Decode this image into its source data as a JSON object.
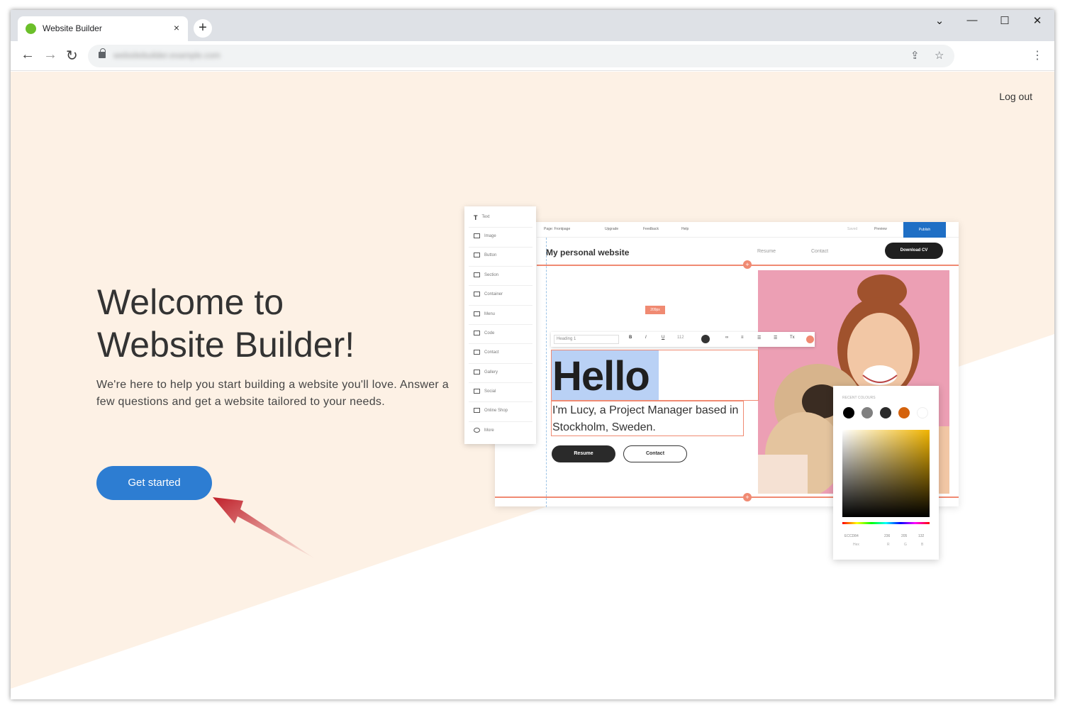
{
  "browser": {
    "tab_title": "Website Builder",
    "tab_close": "×",
    "new_tab": "+",
    "url": "websitebuilder.example.com",
    "controls": {
      "minimize": "—",
      "maximize": "☐",
      "close": "✕",
      "tablist": "⌄"
    }
  },
  "page": {
    "logout": "Log out",
    "title_line1": "Welcome to",
    "title_line2": "Website Builder!",
    "intro": "We're here to help you start building a website you'll love. Answer a few questions and get a website tailored to your needs.",
    "cta": "Get started"
  },
  "mockup": {
    "panel_items": [
      "Text",
      "Image",
      "Button",
      "Section",
      "Container",
      "Menu",
      "Code",
      "Contact",
      "Gallery",
      "Social",
      "Online Shop",
      "More"
    ],
    "topbar": {
      "page": "Page: Frontpage",
      "upgrade": "Upgrade",
      "feedback": "Feedback",
      "help": "Help",
      "saved": "Saved",
      "preview": "Preview",
      "publish": "Publish"
    },
    "site_title": "My personal website",
    "nav": [
      "Resume",
      "Contact"
    ],
    "download_cv": "Download CV",
    "size_tag": "209px",
    "format": {
      "style": "Heading 1",
      "size": "112"
    },
    "hello": "Hello",
    "lucy": "I'm Lucy, a Project Manager based in Stockholm, Sweden.",
    "btn_resume": "Resume",
    "btn_contact": "Contact",
    "picker": {
      "label": "RECENT COLOURS",
      "swatches": [
        "#000000",
        "#808080",
        "#2a2a2a",
        "#d4620c",
        "#ffffff"
      ],
      "hex": "ECCD84",
      "r": "236",
      "g": "205",
      "b": "132",
      "hex_label": "Hex",
      "r_label": "R",
      "g_label": "G",
      "b_label": "B"
    }
  },
  "colors": {
    "bg_beige": "#fdf1e5",
    "cta_blue": "#2d7dd2",
    "accent_coral": "#f08a72",
    "arrow_red": "#c0202a"
  }
}
